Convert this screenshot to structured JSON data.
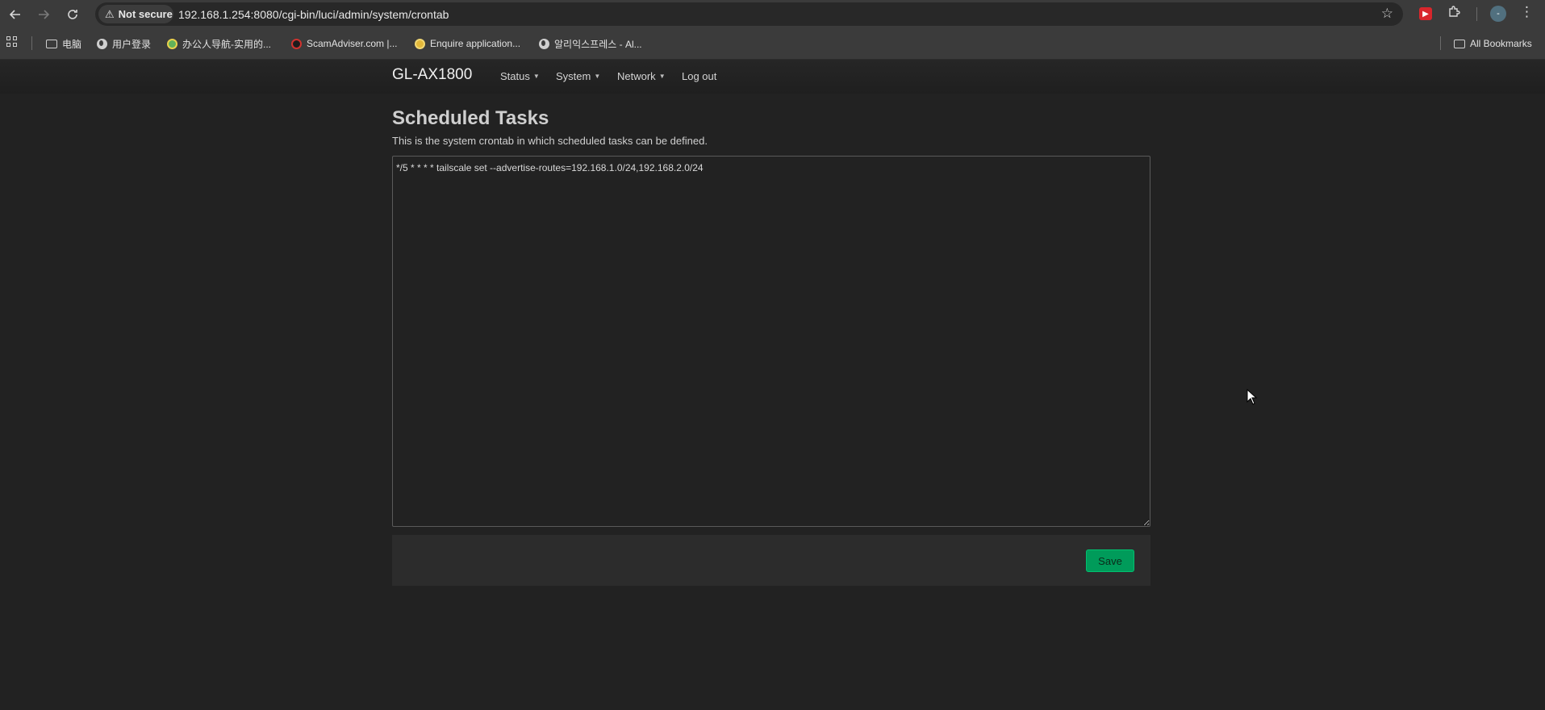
{
  "browser": {
    "security_label": "Not secure",
    "url": "192.168.1.254:8080/cgi-bin/luci/admin/system/crontab",
    "profile_initial": "-",
    "bookmarks": [
      {
        "label": "电脑",
        "icon": "folder-icon"
      },
      {
        "label": "用户登录",
        "icon": "globe-icon"
      },
      {
        "label": "办公人导航-实用的...",
        "icon": "site-favicon"
      },
      {
        "label": "ScamAdviser.com |...",
        "icon": "scamadviser-favicon"
      },
      {
        "label": "Enquire application...",
        "icon": "site-favicon"
      },
      {
        "label": "알리익스프레스 - Al...",
        "icon": "globe-icon"
      }
    ],
    "all_bookmarks_label": "All Bookmarks"
  },
  "luci": {
    "brand": "GL-AX1800",
    "menu": [
      {
        "label": "Status",
        "dropdown": true
      },
      {
        "label": "System",
        "dropdown": true
      },
      {
        "label": "Network",
        "dropdown": true
      },
      {
        "label": "Log out",
        "dropdown": false
      }
    ]
  },
  "page": {
    "title": "Scheduled Tasks",
    "description": "This is the system crontab in which scheduled tasks can be defined.",
    "crontab_value": "*/5 * * * * tailscale set --advertise-routes=192.168.1.0/24,192.168.2.0/24",
    "save_label": "Save"
  },
  "colors": {
    "background": "#222222",
    "save_button": "#009b5a"
  }
}
